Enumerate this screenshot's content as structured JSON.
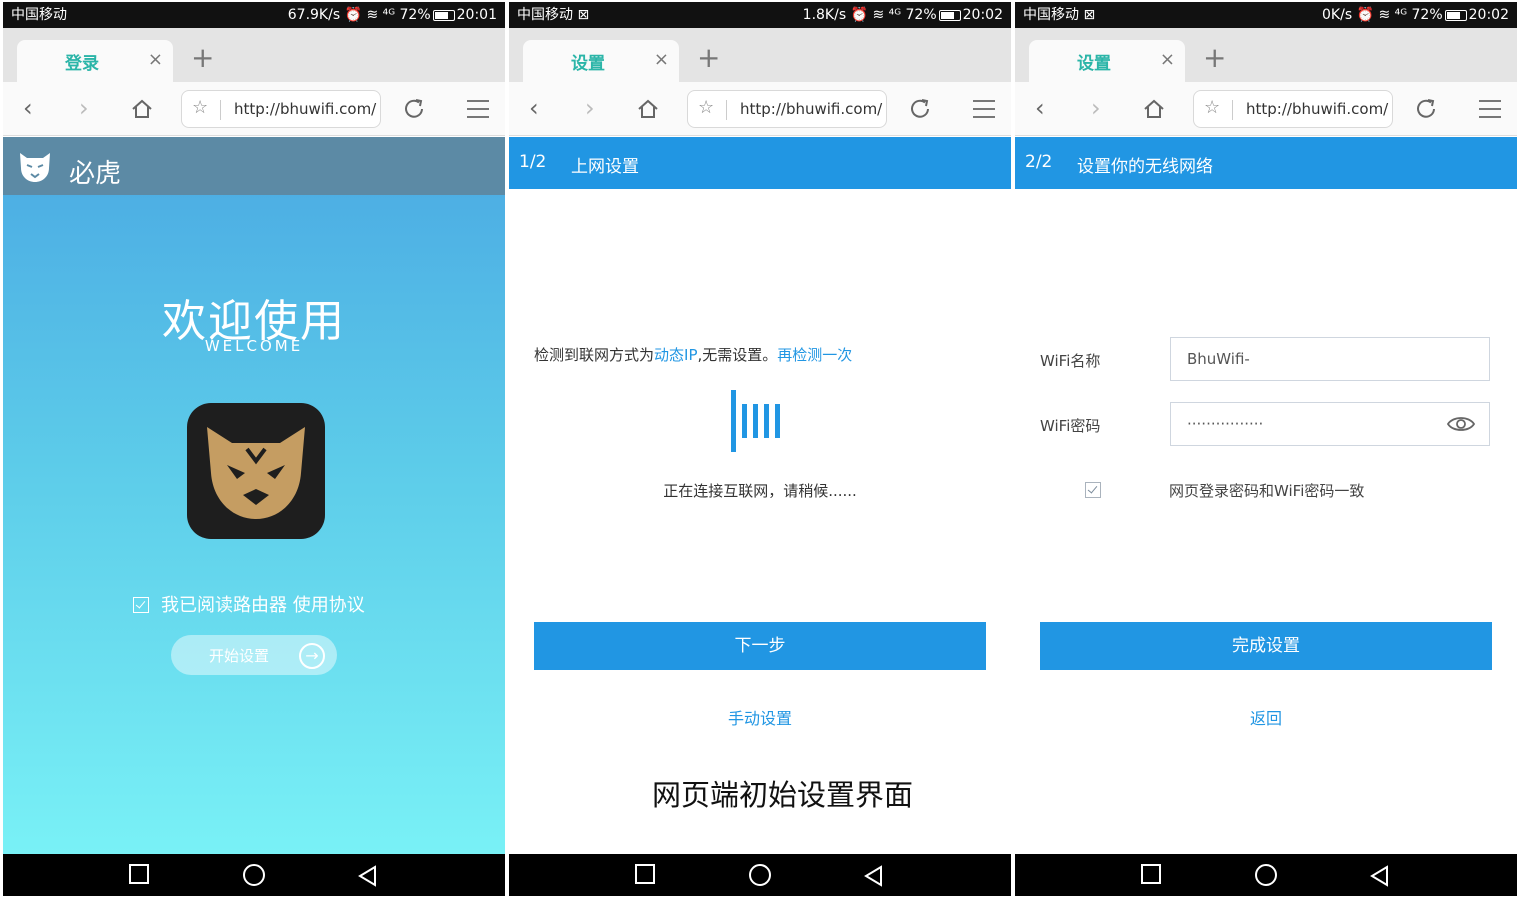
{
  "panels": [
    {
      "status": {
        "carrier": "中国移动",
        "right": "67.9K/s ⏰ ≋ ⁴ᴳ 72%",
        "time": "20:01"
      },
      "tab": {
        "title": "登录",
        "close": "×"
      },
      "url": "http://bhuwifi.com/",
      "brand": "必虎",
      "welcome_cn": "欢迎使用",
      "welcome_en": "WELCOME",
      "agree_text": "我已阅读路由器 使用协议",
      "start_button": "开始设置"
    },
    {
      "status": {
        "carrier": "中国移动 ⊠",
        "right": "1.8K/s ⏰ ≋ ⁴ᴳ 72%",
        "time": "20:02"
      },
      "tab": {
        "title": "设置",
        "close": "×"
      },
      "url": "http://bhuwifi.com/",
      "step": "1/2",
      "step_title": "上网设置",
      "detect_prefix": "检测到联网方式为",
      "detect_type": "动态IP",
      "detect_suffix": ",无需设置。",
      "detect_again": "再检测一次",
      "connecting": "正在连接互联网，请稍候......",
      "next_button": "下一步",
      "manual_link": "手动设置"
    },
    {
      "status": {
        "carrier": "中国移动 ⊠",
        "right": "0K/s ⏰ ≋ ⁴ᴳ 72%",
        "time": "20:02"
      },
      "tab": {
        "title": "设置",
        "close": "×"
      },
      "url": "http://bhuwifi.com/",
      "step": "2/2",
      "step_title": "设置你的无线网络",
      "wifi_name_label": "WiFi名称",
      "wifi_name_value": "BhuWifi-",
      "wifi_pwd_label": "WiFi密码",
      "wifi_pwd_value": "················",
      "sync_text": "网页登录密码和WiFi密码一致",
      "finish_button": "完成设置",
      "back_link": "返回"
    }
  ],
  "caption": "网页端初始设置界面",
  "colors": {
    "accent": "#2196e3",
    "tab_text": "#2bb5a8",
    "header_p1": "#5c8aa5"
  },
  "icons": [
    "back-icon",
    "forward-icon",
    "home-icon",
    "star-icon",
    "refresh-icon",
    "menu-icon",
    "tiger-logo-icon",
    "eye-icon"
  ]
}
